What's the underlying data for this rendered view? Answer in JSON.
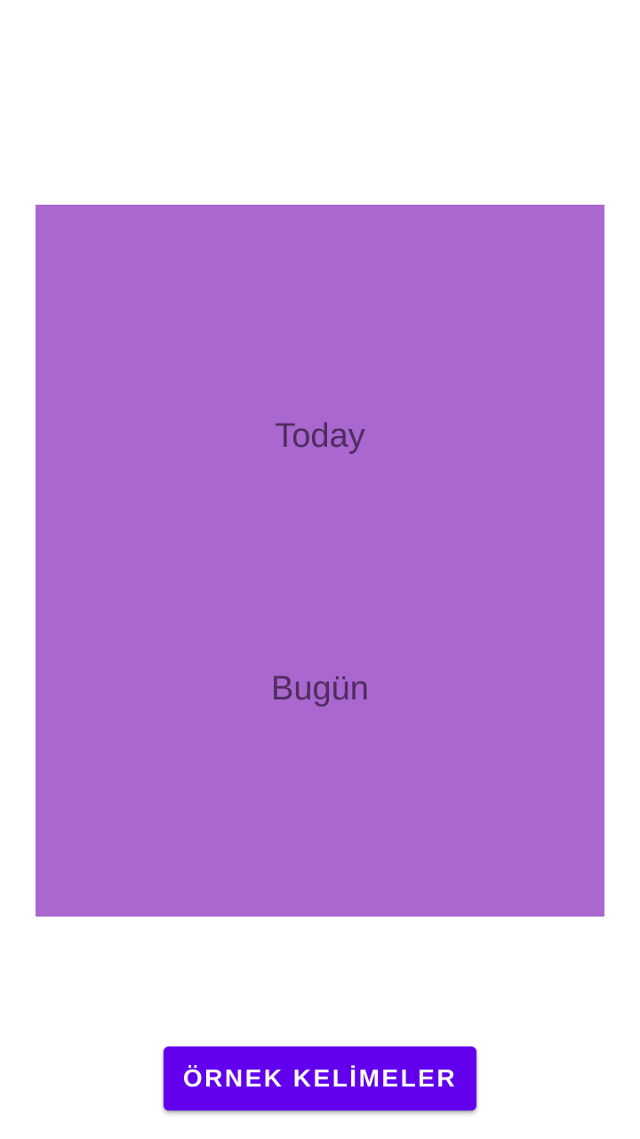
{
  "colors": {
    "background": "#ffffff",
    "card": "#a967cf",
    "card_text": "#4f2d5f",
    "button": "#6200ee",
    "button_text": "#ffffff"
  },
  "card": {
    "word_english": "Today",
    "word_turkish": "Bugün"
  },
  "footer": {
    "sample_words_button_label": "ÖRNEK KELİMELER"
  }
}
